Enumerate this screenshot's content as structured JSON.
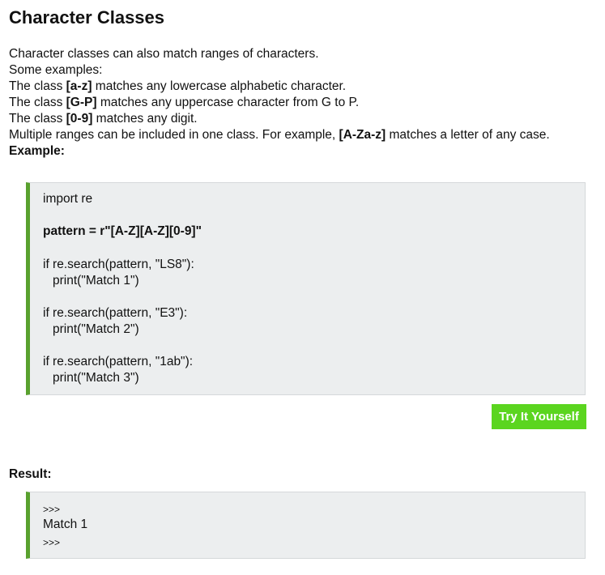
{
  "lesson": {
    "title": "Character Classes",
    "intro": "Character classes can also match ranges of characters.",
    "some_examples": "Some examples:",
    "examples": [
      {
        "prefix": "The class ",
        "pattern": "[a-z]",
        "suffix": " matches any lowercase alphabetic character."
      },
      {
        "prefix": "The class ",
        "pattern": "[G-P]",
        "suffix": " matches any uppercase character from G to P."
      },
      {
        "prefix": "The class ",
        "pattern": "[0-9]",
        "suffix": " matches any digit."
      }
    ],
    "multiple_ranges": {
      "prefix": "Multiple ranges can be included in one class. For example, ",
      "pattern": "[A-Za-z]",
      "suffix": " matches a letter of any case."
    },
    "example_label": "Example:"
  },
  "code": {
    "lines": [
      "import re",
      "pattern = r\"[A-Z][A-Z][0-9]\"",
      "if re.search(pattern, \"LS8\"):",
      "print(\"Match 1\")",
      "if re.search(pattern, \"E3\"):",
      "print(\"Match 2\")",
      "if re.search(pattern, \"1ab\"):",
      "print(\"Match 3\")"
    ]
  },
  "try_button": {
    "label": "Try It Yourself"
  },
  "result": {
    "label": "Result:",
    "prompt_start": ">>>",
    "output": "Match 1",
    "prompt_end": ">>>"
  },
  "colors": {
    "accent_green": "#59a12e",
    "button_green": "#5bd51f",
    "code_background": "#eceeef"
  }
}
